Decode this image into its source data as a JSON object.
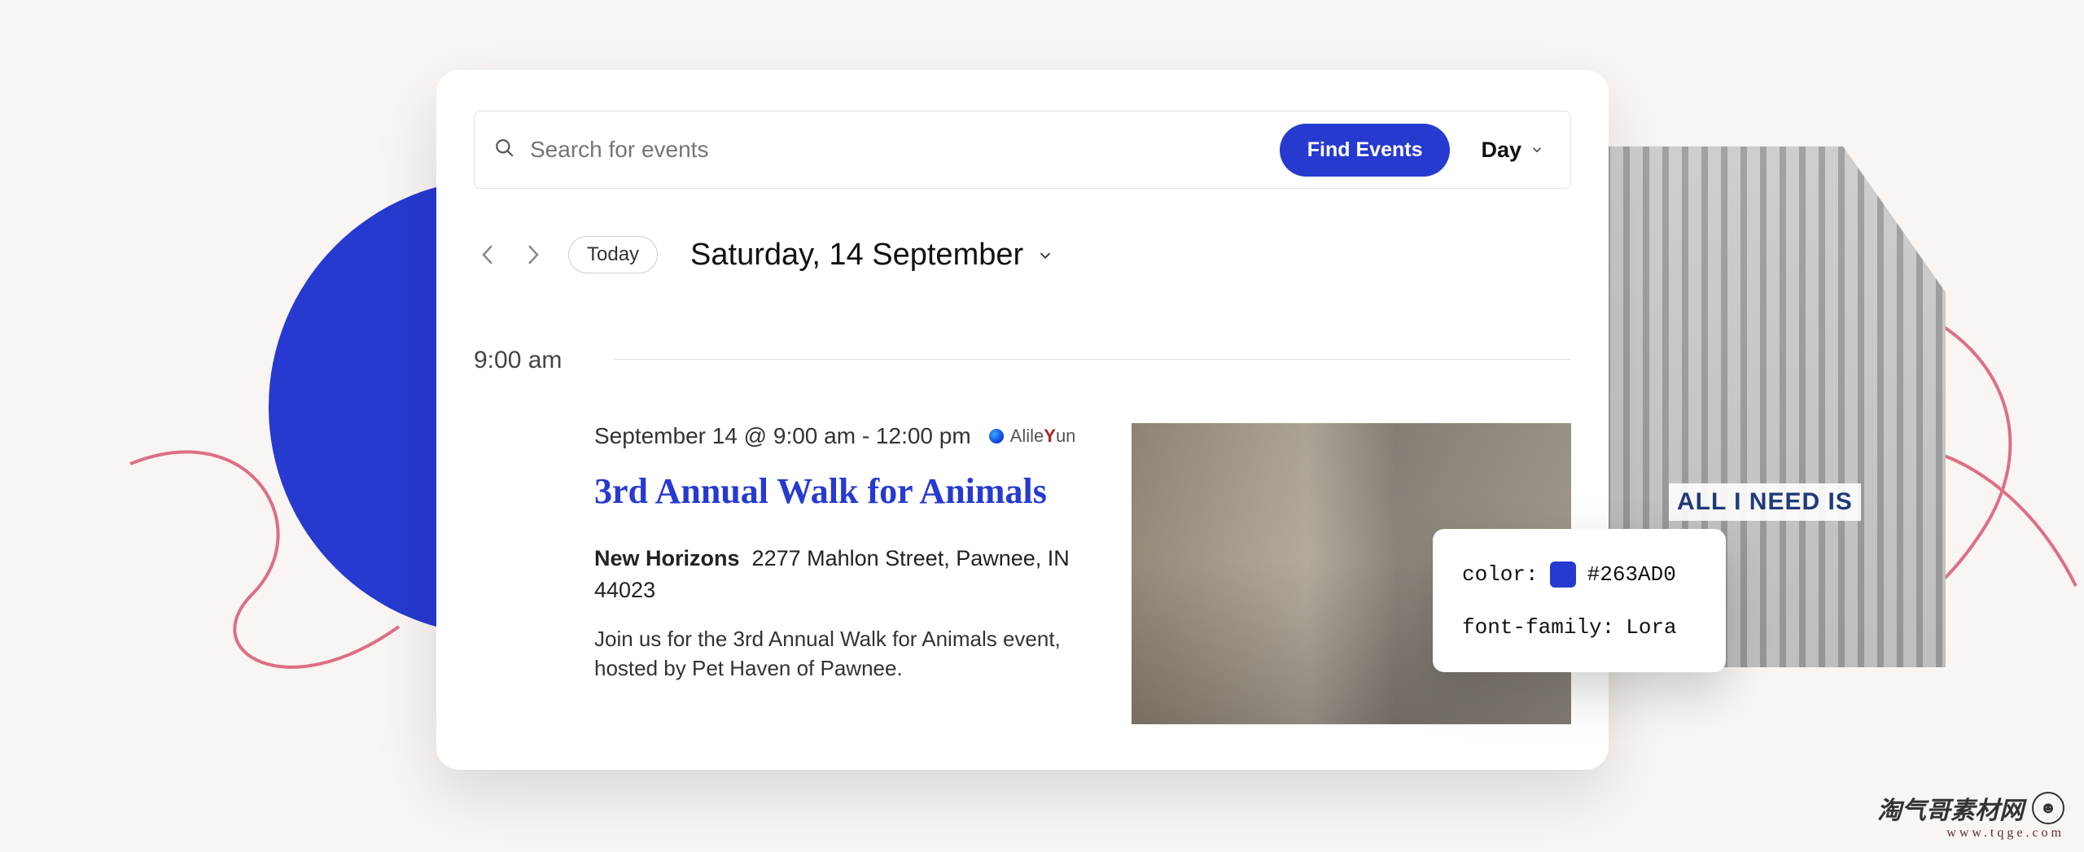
{
  "searchbar": {
    "placeholder": "Search for events",
    "find_button": "Find Events",
    "view_label": "Day"
  },
  "nav": {
    "today_label": "Today",
    "date_heading": "Saturday, 14 September"
  },
  "timeslot": {
    "time_label": "9:00 am"
  },
  "event": {
    "datetime": "September 14 @ 9:00 am - 12:00 pm",
    "badge_text": "Alile",
    "badge_accent": "Y",
    "badge_suffix": "un",
    "title": "3rd Annual Walk for Animals",
    "venue_name": "New Horizons",
    "venue_address": "2277 Mahlon Street, Pawnee, IN 44023",
    "description": "Join us for the 3rd Annual Walk for Animals event, hosted by Pet Haven of Pawnee."
  },
  "callout": {
    "color_label": "color:",
    "color_value": "#263AD0",
    "font_label": "font-family:",
    "font_value": "Lora"
  },
  "right_photo": {
    "tshirt_text": "ALL I NEED IS"
  },
  "watermark": {
    "cn": "淘气哥素材网",
    "url": "www.tqge.com"
  },
  "colors": {
    "accent": "#263AD0",
    "squiggle": "#DD6E86",
    "page_bg": "#f8f5f2"
  }
}
